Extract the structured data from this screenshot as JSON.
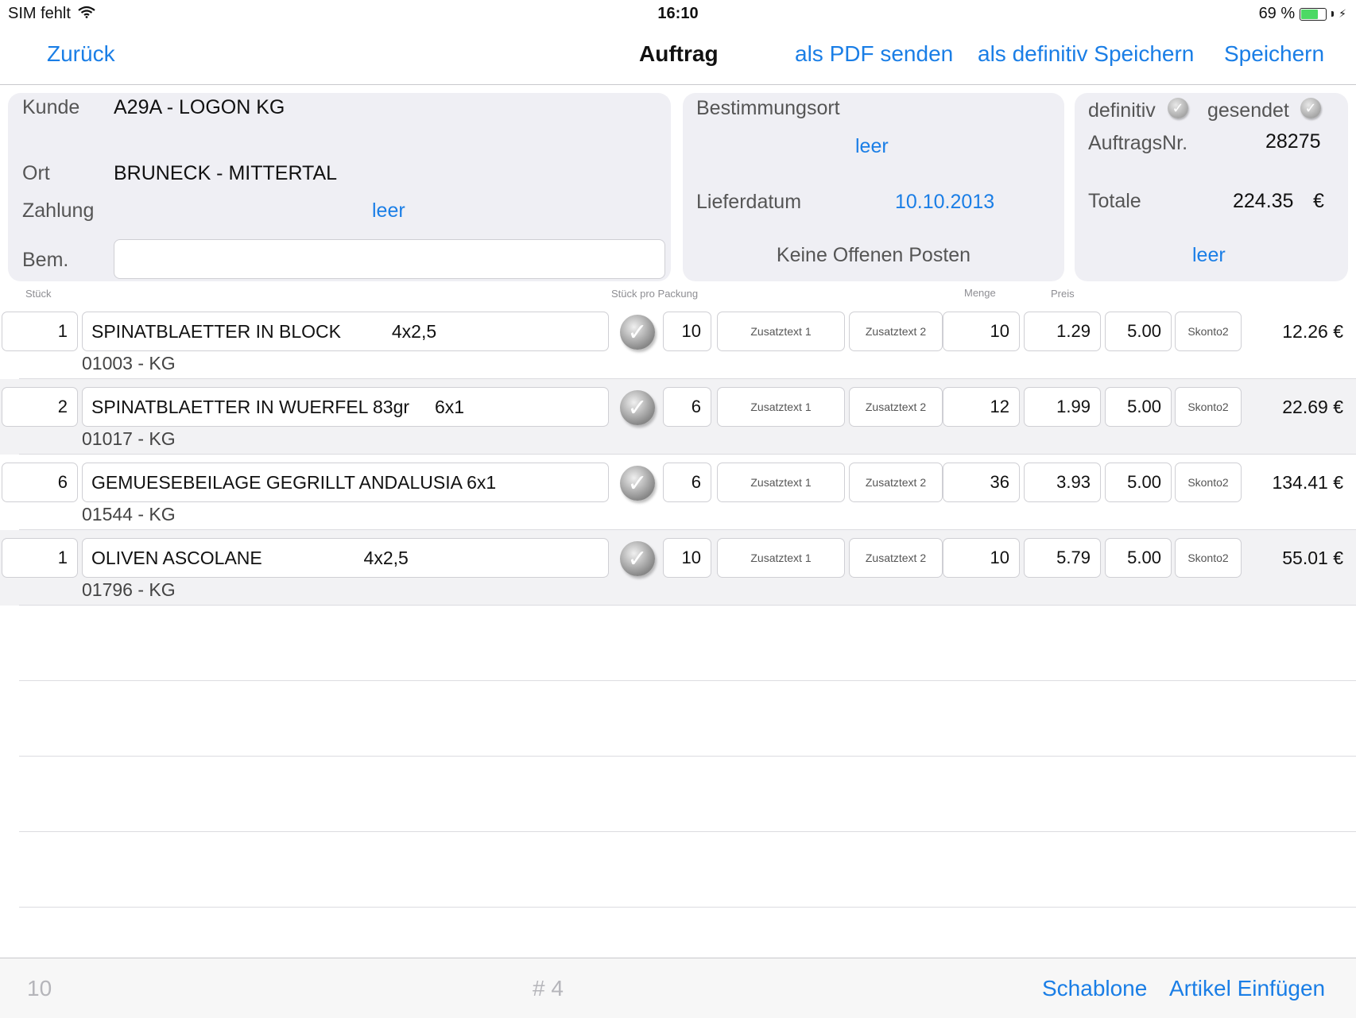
{
  "status_bar": {
    "carrier": "SIM fehlt",
    "time": "16:10",
    "battery": "69 %"
  },
  "nav": {
    "back": "Zurück",
    "title": "Auftrag",
    "pdf": "als PDF senden",
    "definitiv": "als definitiv Speichern",
    "save": "Speichern"
  },
  "customer": {
    "kunde_label": "Kunde",
    "kunde_value": "A29A - LOGON KG",
    "ort_label": "Ort",
    "ort_value": "BRUNECK - MITTERTAL",
    "zahlung_label": "Zahlung",
    "zahlung_value": "leer",
    "bem_label": "Bem.",
    "bem_value": ""
  },
  "delivery": {
    "bestimmungsort_label": "Bestimmungsort",
    "bestimmungsort_value": "leer",
    "lieferdatum_label": "Lieferdatum",
    "lieferdatum_value": "10.10.2013",
    "offene_posten": "Keine Offenen Posten"
  },
  "order": {
    "definitiv_label": "definitiv",
    "gesendet_label": "gesendet",
    "auftragsnr_label": "AuftragsNr.",
    "auftragsnr_value": "28275",
    "totale_label": "Totale",
    "totale_value": "224.35",
    "currency": "€",
    "extra_link": "leer"
  },
  "columns": {
    "stueck": "Stück",
    "stueck_pro_packung": "Stück pro Packung",
    "menge": "Menge",
    "preis": "Preis"
  },
  "items": [
    {
      "qty": "1",
      "name": "SPINATBLAETTER IN BLOCK          4x2,5",
      "code": "01003 - KG",
      "pack": "10",
      "zusatz1": "Zusatztext 1",
      "zusatz2": "Zusatztext 2",
      "menge": "10",
      "preis": "1.29",
      "rabatt": "5.00",
      "skonto": "Skonto2",
      "total": "12.26 €"
    },
    {
      "qty": "2",
      "name": "SPINATBLAETTER IN WUERFEL 83gr     6x1",
      "code": "01017 - KG",
      "pack": "6",
      "zusatz1": "Zusatztext 1",
      "zusatz2": "Zusatztext 2",
      "menge": "12",
      "preis": "1.99",
      "rabatt": "5.00",
      "skonto": "Skonto2",
      "total": "22.69 €"
    },
    {
      "qty": "6",
      "name": "GEMUESEBEILAGE GEGRILLT ANDALUSIA 6x1",
      "code": "01544 - KG",
      "pack": "6",
      "zusatz1": "Zusatztext 1",
      "zusatz2": "Zusatztext 2",
      "menge": "36",
      "preis": "3.93",
      "rabatt": "5.00",
      "skonto": "Skonto2",
      "total": "134.41 €"
    },
    {
      "qty": "1",
      "name": "OLIVEN ASCOLANE                    4x2,5",
      "code": "01796 - KG",
      "pack": "10",
      "zusatz1": "Zusatztext 1",
      "zusatz2": "Zusatztext 2",
      "menge": "10",
      "preis": "5.79",
      "rabatt": "5.00",
      "skonto": "Skonto2",
      "total": "55.01 €"
    }
  ],
  "footer": {
    "count": "10",
    "position": "# 4",
    "schablone": "Schablone",
    "artikel": "Artikel Einfügen"
  }
}
